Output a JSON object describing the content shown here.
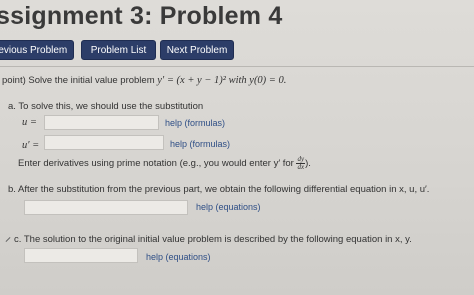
{
  "header": {
    "title": "ssignment 3: Problem 4"
  },
  "nav": {
    "previous_label": "revious Problem",
    "list_label": "Problem List",
    "next_label": "Next Problem"
  },
  "problem": {
    "intro_prefix": "point) Solve the initial value problem ",
    "intro_equation": "y′ = (x + y − 1)² with y(0) = 0."
  },
  "part_a": {
    "label": "a. To solve this, we should use the substitution",
    "u_label": "u =",
    "u_help": "help (formulas)",
    "uprime_label": "u′ =",
    "uprime_help": "help (formulas)",
    "note_text": "Enter derivatives using prime notation (e.g., you would enter y′ for",
    "note_frac_num": "dy",
    "note_frac_den": "dx",
    "note_end": ")."
  },
  "part_b": {
    "label": "b. After the substitution from the previous part, we obtain the following differential equation in x, u, u′.",
    "help": "help (equations)"
  },
  "part_c": {
    "label": "c. The solution to the original initial value problem is described by the following equation in x, y.",
    "help": "help (equations)"
  }
}
